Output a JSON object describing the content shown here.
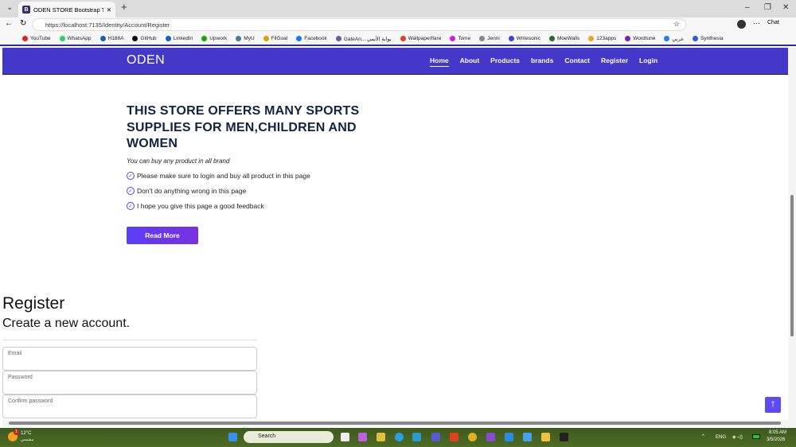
{
  "browser": {
    "tab_title": "ODEN STORE Bootstrap Template",
    "tab_favicon": "B",
    "url": "https://localhost:7135/Identity/Account/Register",
    "bookmarks": [
      {
        "label": "YouTube",
        "color": "#e62117"
      },
      {
        "label": "WhatsApp",
        "color": "#25d366"
      },
      {
        "label": "H188A",
        "color": "#1a5fb4"
      },
      {
        "label": "GitHub",
        "color": "#111111"
      },
      {
        "label": "LinkedIn",
        "color": "#0a66c2"
      },
      {
        "label": "Upwork",
        "color": "#14a800"
      },
      {
        "label": "MyU",
        "color": "#4a7a9a"
      },
      {
        "label": "FilGoal",
        "color": "#e0a000"
      },
      {
        "label": "Facebook",
        "color": "#1877f2"
      },
      {
        "label": "GateAn... بوابة الأنمي",
        "color": "#6060a0"
      },
      {
        "label": "Wallpaperflare",
        "color": "#e04020"
      },
      {
        "label": "Tome",
        "color": "#d020d0"
      },
      {
        "label": "Jenni",
        "color": "#888888"
      },
      {
        "label": "Writesonic",
        "color": "#4040e0"
      },
      {
        "label": "MoeWalls",
        "color": "#2a6a2a"
      },
      {
        "label": "123apps",
        "color": "#f0a020"
      },
      {
        "label": "Wordtune",
        "color": "#7a20c0"
      },
      {
        "label": "عربي",
        "color": "#2080e0"
      },
      {
        "label": "Synthesia",
        "color": "#2060e0"
      }
    ],
    "chat_label": "Chat"
  },
  "nav": {
    "brand": "ODEN",
    "items": [
      "Home",
      "About",
      "Products",
      "brands",
      "Contact",
      "Register",
      "Login"
    ],
    "active": "Home",
    "color": "#4338c7"
  },
  "hero": {
    "title": "THIS STORE OFFERS MANY SPORTS SUPPLIES FOR MEN,CHILDREN AND WOMEN",
    "subtitle": "You can buy any product in all brand",
    "list": [
      "Please make sure to login and buy all product in this page",
      "Don't do anything wrong in this page",
      "I hope you give this page a good feedback"
    ],
    "button": "Read More"
  },
  "register": {
    "title": "Register",
    "subtitle": "Create a new account.",
    "fields": {
      "email": "Email",
      "password": "Password",
      "confirm": "Confirm password"
    }
  },
  "taskbar": {
    "weather_temp": "12°C",
    "weather_desc": "مشمس",
    "weather_badge": "1",
    "search": "Search",
    "lang": "ENG",
    "time": "8:05 AM",
    "date": "3/5/2026"
  }
}
